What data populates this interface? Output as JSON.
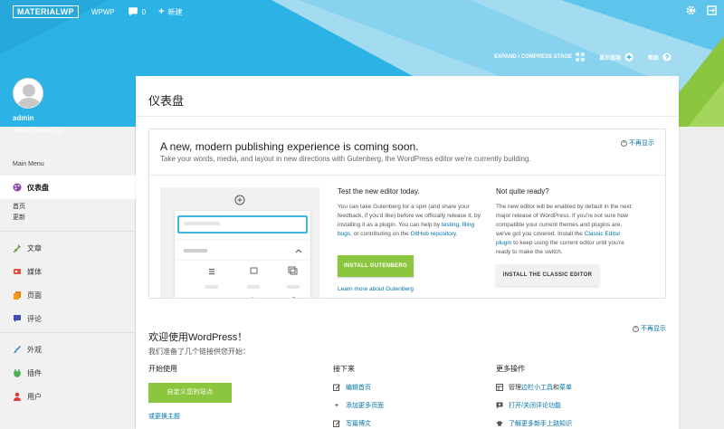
{
  "topbar": {
    "logo_a": "MATERIAL",
    "logo_b": "WP",
    "site_name": "WPWP",
    "comments_count": "0",
    "new_label": "新建"
  },
  "subbar": {
    "expand": "EXPAND / COMPRESS STAGE",
    "screen_options": "显示选项",
    "help": "帮助"
  },
  "user": {
    "name": "admin",
    "email": "admin@wpwp.xyz"
  },
  "sidebar": {
    "menu_title": "Main Menu",
    "dashboard": "仪表盘",
    "sub_home": "首页",
    "sub_updates": "更新",
    "items": [
      "文章",
      "媒体",
      "页面",
      "评论"
    ],
    "items2": [
      "外观",
      "插件",
      "用户"
    ]
  },
  "page": {
    "title": "仪表盘"
  },
  "gutenberg": {
    "title": "A new, modern publishing experience is coming soon.",
    "lead": "Take your words, media, and layout in new directions with Gutenberg, the WordPress editor we're currently building.",
    "dismiss": "不再显示",
    "col1_title": "Test the new editor today.",
    "col1_text_a": "You can take Gutenberg for a spin (and share your feedback, if you'd like) before we officially release it, by installing it as a plugin. You can help by ",
    "col1_link_testing": "testing",
    "col1_comma": ", ",
    "col1_link_filing": "filing bugs",
    "col1_text_b": ", or contributing on the ",
    "col1_link_github": "GitHub repository",
    "col1_period": ".",
    "install_btn": "INSTALL GUTENBERG",
    "learn_more": "Learn more about Gutenberg",
    "col2_title": "Not quite ready?",
    "col2_text_a": "The new editor will be enabled by default in the next major release of WordPress. If you're not sure how compatible your current themes and plugins are, we've got you covered. Install the ",
    "col2_link": "Classic Editor plugin",
    "col2_text_b": " to keep using the current editor until you're ready to make the switch.",
    "classic_btn": "INSTALL THE CLASSIC EDITOR"
  },
  "welcome": {
    "title": "欢迎使用WordPress！",
    "subtitle": "我们准备了几个链接供您开始：",
    "dismiss": "不再显示",
    "start_title": "开始使用",
    "start_btn": "自定义您的站点",
    "start_link": "或更换主题",
    "next_title": "接下来",
    "next_links": [
      "编辑首页",
      "添加更多页面",
      "写篇博文"
    ],
    "more_title": "更多操作",
    "more_a_prefix": "管理",
    "more_a_link1": "边栏小工具",
    "more_a_mid": "和",
    "more_a_link2": "菜单",
    "more_b": "打开/关闭评论功能",
    "more_c": "了解更多新手上路知识"
  },
  "colors": {
    "accent": "#8cc63f",
    "link": "#0073aa",
    "hero": "#2ab1e5"
  }
}
